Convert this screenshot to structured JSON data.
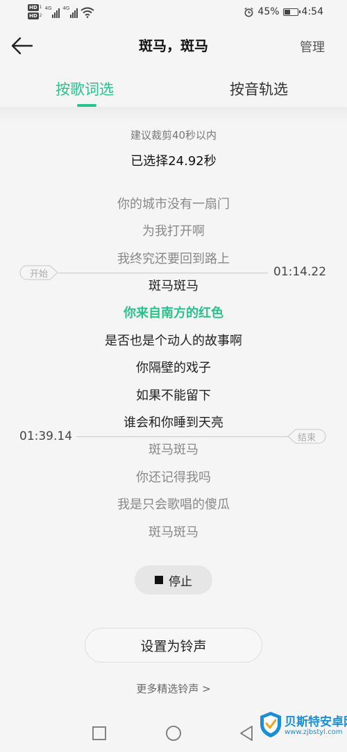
{
  "status_bar": {
    "hd1": "HD",
    "hd2": "HD",
    "net1": "4G",
    "net2": "4G",
    "battery_percent": "45%",
    "battery_level": 0.45,
    "time": "4:54"
  },
  "header": {
    "title": "斑马，斑马",
    "manage_label": "管理"
  },
  "tabs": [
    {
      "label": "按歌词选",
      "active": true
    },
    {
      "label": "按音轨选",
      "active": false
    }
  ],
  "hint": "建议裁剪40秒以内",
  "selected_duration": "已选择24.92秒",
  "lyrics": [
    "你的城市没有一扇门",
    "为我打开啊",
    "我终究还要回到路上",
    "斑马斑马",
    "你来自南方的红色",
    "是否也是个动人的故事啊",
    "你隔壁的戏子",
    "如果不能留下",
    "谁会和你睡到天亮",
    "斑马斑马",
    "你还记得我吗",
    "我是只会歌唱的傻瓜",
    "斑马斑马"
  ],
  "start_marker": {
    "label": "开始",
    "time": "01:14.22"
  },
  "end_marker": {
    "label": "结束",
    "time": "01:39.14"
  },
  "stop_label": "停止",
  "set_ringtone_label": "设置为铃声",
  "more_link": "更多精选铃声 >",
  "watermark": {
    "title": "贝斯特安卓网",
    "url": "www.zjbstyl.com"
  },
  "colors": {
    "accent": "#28c28b",
    "watermark": "#1a8fd6"
  }
}
